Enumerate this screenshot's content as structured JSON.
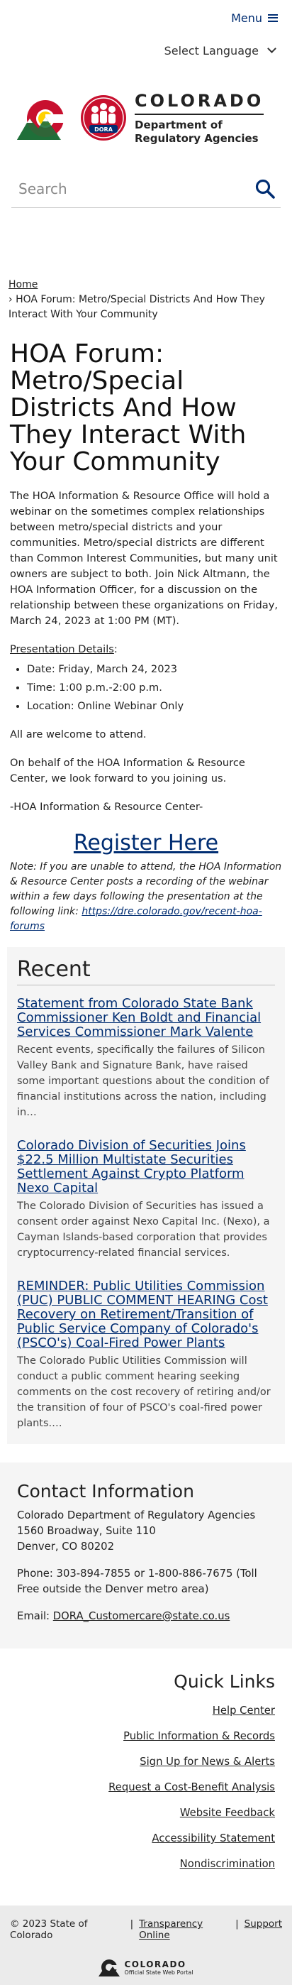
{
  "header": {
    "menu_label": "Menu",
    "language_label": "Select Language"
  },
  "branding": {
    "title": "COLORADO",
    "subtitle_line1": "Department of",
    "subtitle_line2": "Regulatory Agencies",
    "dora_badge": "DORA"
  },
  "search": {
    "placeholder": "Search"
  },
  "breadcrumb": {
    "home": "Home",
    "current": "HOA Forum: Metro/Special Districts And How They Interact With Your Community"
  },
  "page": {
    "title": "HOA Forum: Metro/Special Districts And How They Interact With Your Community",
    "intro": "The HOA Information & Resource Office will hold a webinar on the sometimes complex relationships between metro/special districts and your communities. Metro/special districts are different than Common Interest Communities, but many unit owners are subject to both. Join Nick Altmann, the HOA Information Officer, for a discussion on the relationship between these organizations on Friday, March 24, 2023 at 1:00 PM (MT).",
    "details_label": "Presentation Details",
    "details_colon": ":",
    "details": [
      "Date: Friday, March 24, 2023",
      "Time: 1:00 p.m.-2:00 p.m.",
      "Location: Online Webinar Only"
    ],
    "welcome": "All are welcome to attend.",
    "closing": "On behalf of the HOA Information & Resource Center, we look forward to you joining us.",
    "signature": "-HOA Information & Resource Center-",
    "register_label": "Register Here",
    "note": "Note: If you are unable to attend, the HOA Information & Resource Center posts a recording of the webinar within a few days following the presentation at the following link: ",
    "note_link": "https://dre.colorado.gov/recent-hoa-forums"
  },
  "recent": {
    "heading": "Recent",
    "items": [
      {
        "title": "Statement from Colorado State Bank Commissioner Ken Boldt and Financial Services Commissioner Mark Valente",
        "summary": "Recent events, specifically the failures of Silicon Valley Bank and Signature Bank, have raised some important questions about the condition of financial institutions across the nation, including in…"
      },
      {
        "title": "Colorado Division of Securities Joins $22.5 Million Multistate Securities Settlement Against Crypto Platform Nexo Capital",
        "summary": "The Colorado Division of Securities has issued a consent order against Nexo Capital Inc. (Nexo), a Cayman Islands-based corporation that provides cryptocurrency-related financial services."
      },
      {
        "title": "REMINDER: Public Utilities Commission (PUC) PUBLIC COMMENT HEARING Cost Recovery on Retirement/Transition of Public Service Company of Colorado's (PSCO's) Coal-Fired Power Plants",
        "summary": "The Colorado Public Utilities Commission will conduct a public comment hearing seeking comments on the cost recovery of retiring and/or the transition of four of PSCO's coal-fired power plants.…"
      }
    ]
  },
  "contact": {
    "heading": "Contact Information",
    "address_lines": [
      "Colorado Department of Regulatory Agencies",
      "1560 Broadway, Suite 110",
      "Denver, CO 80202"
    ],
    "phone": "Phone: 303-894-7855 or 1-800-886-7675 (Toll Free outside the Denver metro area)",
    "email_label": "Email: ",
    "email": "DORA_Customercare@state.co.us"
  },
  "quick_links": {
    "heading": "Quick Links",
    "items": [
      "Help Center",
      "Public Information & Records",
      "Sign Up for News & Alerts",
      "Request a Cost-Benefit Analysis",
      "Website Feedback",
      "Accessibility Statement",
      "Nondiscrimination"
    ]
  },
  "footer": {
    "copyright": "© 2023 State of Colorado",
    "transparency": "Transparency Online",
    "support": "Support",
    "portal_title": "COLORADO",
    "portal_sub": "Official State Web Portal"
  },
  "colors": {
    "brand_blue": "#002d72",
    "dora_red": "#c8102e",
    "co_yellow": "#ffd100",
    "green": "#1f6f3a"
  },
  "icons": [
    "hamburger-icon",
    "chevron-down-icon",
    "search-icon",
    "colorado-logo-icon",
    "dora-logo-icon"
  ]
}
